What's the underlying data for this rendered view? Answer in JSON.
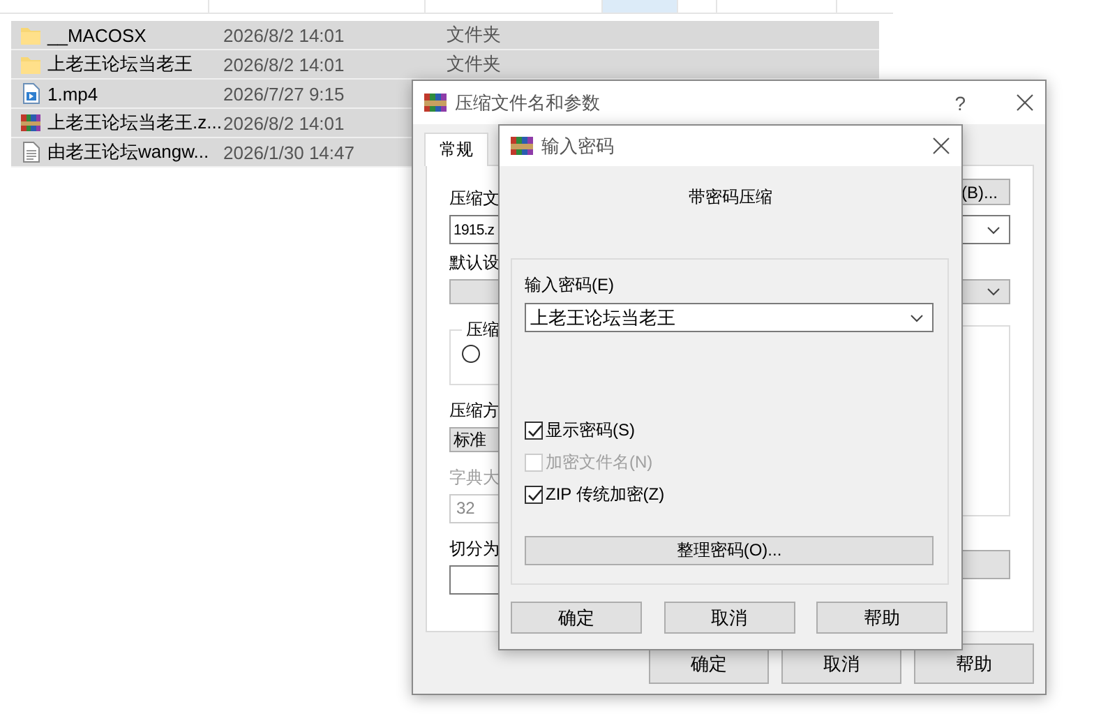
{
  "explorer": {
    "rows": [
      {
        "kind": "folder",
        "name": "__MACOSX",
        "date": "2026/8/2 14:01",
        "type": "文件夹",
        "selected": true
      },
      {
        "kind": "folder",
        "name": "上老王论坛当老王",
        "date": "2026/8/2 14:01",
        "type": "文件夹",
        "selected": true
      },
      {
        "kind": "video",
        "name": "1.mp4",
        "date": "2026/7/27 9:15",
        "selected": true
      },
      {
        "kind": "archive",
        "name": "上老王论坛当老王.z...",
        "date": "2026/8/2 14:01",
        "selected": true
      },
      {
        "kind": "text",
        "name": "由老王论坛wangw...",
        "date": "2026/1/30 14:47",
        "selected": true
      }
    ]
  },
  "archive_dialog": {
    "title": "压缩文件名和参数",
    "help": "?",
    "tabs": [
      {
        "label": "常规",
        "selected": true
      }
    ],
    "archive_name_label": "压缩文",
    "browse_button": "(B)...",
    "archive_name": "1915.z",
    "profile_label": "默认设",
    "group_label": "压缩",
    "radio": {
      "selected": false
    },
    "method_label": "压缩方",
    "method": "标准",
    "dictionary": {
      "label": "字典大",
      "value": "32",
      "disabled": true
    },
    "split_label": "切分为",
    "buttons": [
      "确定",
      "取消",
      "帮助"
    ]
  },
  "password_dialog": {
    "title": "输入密码",
    "heading": "带密码压缩",
    "password_label": "输入密码(E)",
    "password": "上老王论坛当老王",
    "options": [
      {
        "label": "显示密码(S)",
        "checked": true,
        "disabled": false
      },
      {
        "label": "加密文件名(N)",
        "checked": false,
        "disabled": true
      },
      {
        "label": "ZIP 传统加密(Z)",
        "checked": true,
        "disabled": false
      }
    ],
    "organize_button": "整理密码(O)...",
    "buttons": [
      "确定",
      "取消",
      "帮助"
    ]
  }
}
